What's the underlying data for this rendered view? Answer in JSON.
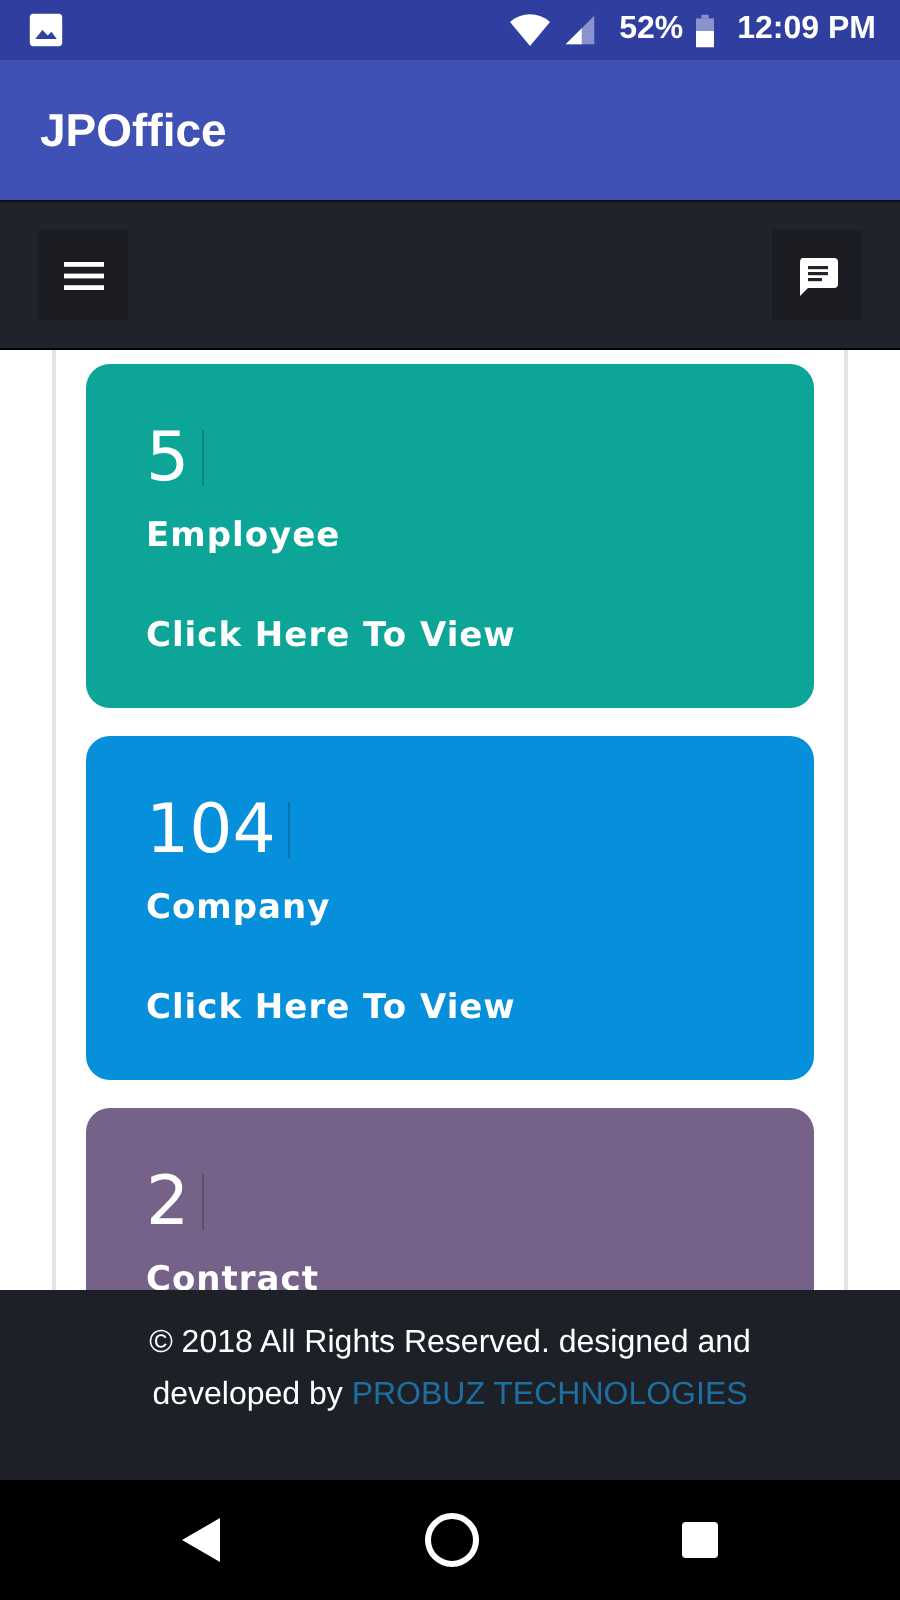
{
  "status_bar": {
    "battery": "52%",
    "time": "12:09 PM"
  },
  "app_bar": {
    "title": "JPOffice"
  },
  "cards": [
    {
      "count": "5",
      "label": "Employee",
      "link": "Click Here To View",
      "color": "#0ca597"
    },
    {
      "count": "104",
      "label": "Company",
      "link": "Click Here To View",
      "color": "#068fdb"
    },
    {
      "count": "2",
      "label": "Contract",
      "color": "#766189"
    }
  ],
  "footer": {
    "text": "© 2018 All Rights Reserved. designed and developed by",
    "link": "PROBUZ TECHNOLOGIES"
  }
}
